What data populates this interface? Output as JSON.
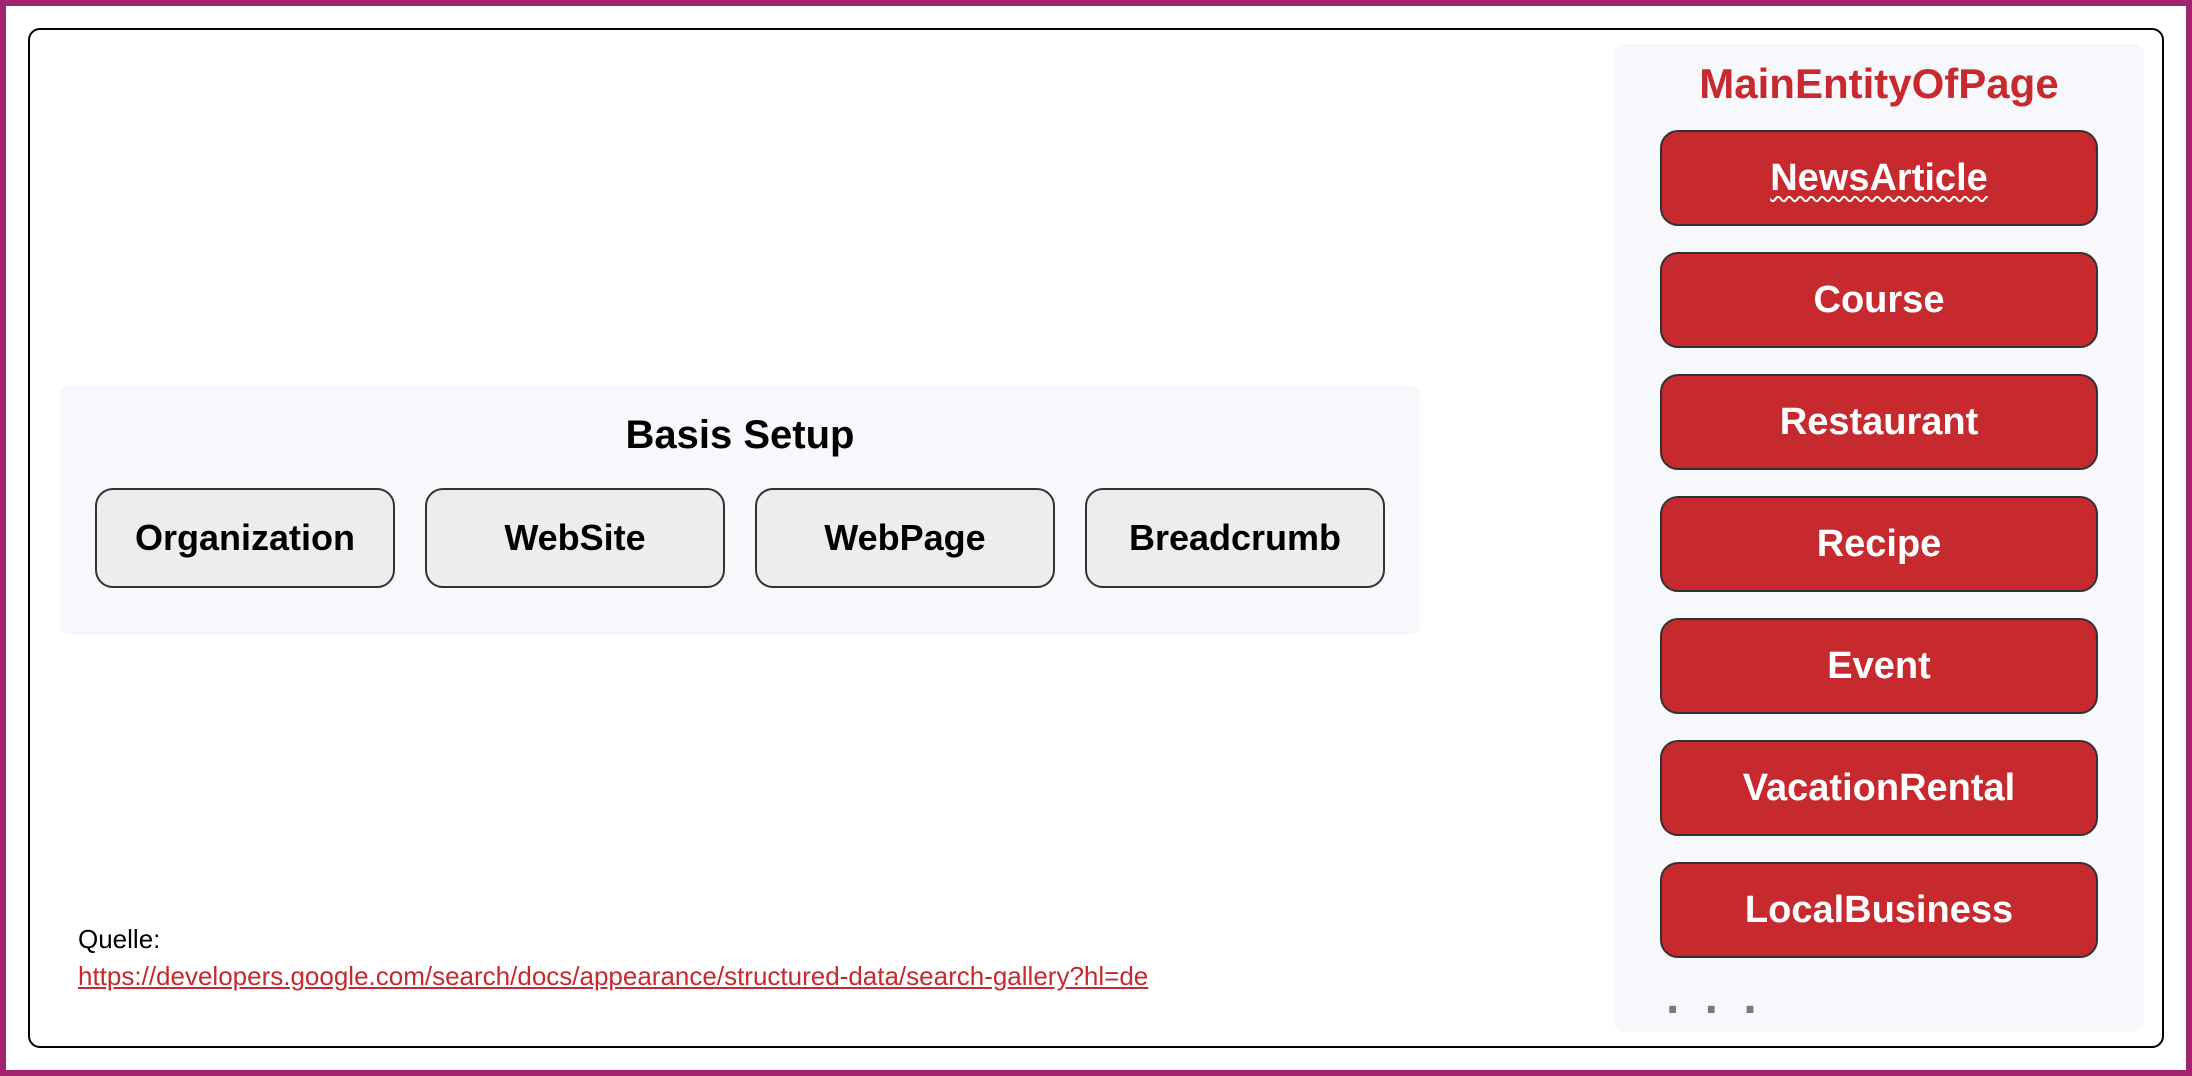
{
  "basis": {
    "title": "Basis Setup",
    "items": [
      "Organization",
      "WebSite",
      "WebPage",
      "Breadcrumb"
    ]
  },
  "entity": {
    "title": "MainEntityOfPage",
    "items": [
      {
        "label": "NewsArticle",
        "squiggle": true
      },
      {
        "label": "Course"
      },
      {
        "label": "Restaurant"
      },
      {
        "label": "Recipe"
      },
      {
        "label": "Event"
      },
      {
        "label": "VacationRental"
      },
      {
        "label": "LocalBusiness"
      }
    ],
    "ellipsis": ". . ."
  },
  "source": {
    "label": "Quelle:",
    "url": "https://developers.google.com/search/docs/appearance/structured-data/search-gallery?hl=de"
  }
}
